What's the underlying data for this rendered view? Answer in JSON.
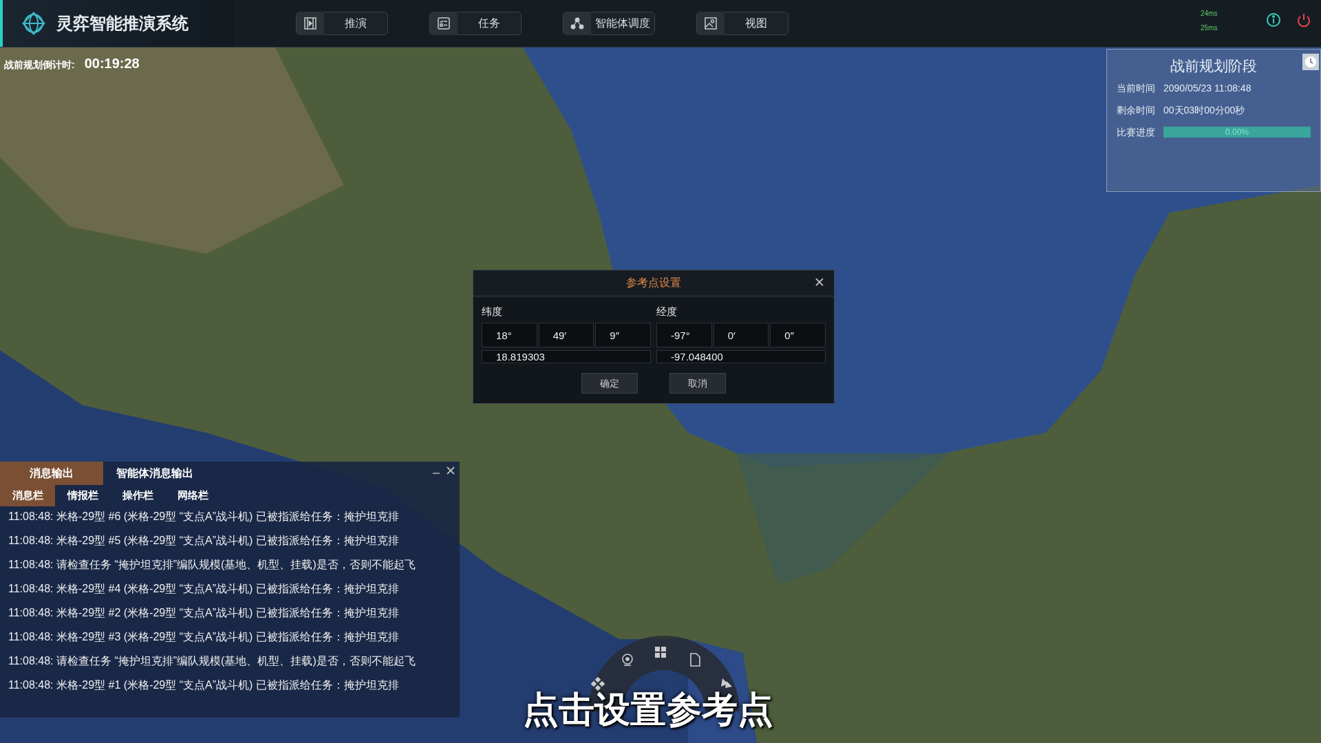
{
  "app": {
    "title": "灵弈智能推演系统"
  },
  "nav": [
    {
      "label": "推演"
    },
    {
      "label": "任务"
    },
    {
      "label": "智能体调度"
    },
    {
      "label": "视图"
    }
  ],
  "latency": [
    "24ms",
    "25ms"
  ],
  "countdown": {
    "label": "战前规划倒计时:",
    "value": "00:19:28"
  },
  "phase_panel": {
    "title": "战前规划阶段",
    "rows": [
      {
        "label": "当前时间",
        "value": "2090/05/23 11:08:48"
      },
      {
        "label": "剩余时间",
        "value": "00天03时00分00秒"
      }
    ],
    "progress": {
      "label": "比赛进度",
      "level": 0,
      "reading": "0.00%"
    }
  },
  "dialog": {
    "title": "参考点设置",
    "latitude": {
      "label": "纬度",
      "parts": [
        "18°",
        "49′",
        "9″"
      ],
      "decimal": "18.819303"
    },
    "longitude": {
      "label": "经度",
      "parts": [
        "-97°",
        "0′",
        "0″"
      ],
      "decimal": "-97.048400"
    },
    "buttons": [
      "确定",
      "取消"
    ]
  },
  "messages": {
    "tabs": [
      {
        "label": "消息输出",
        "selected": true
      },
      {
        "label": "智能体消息输出",
        "selected": false
      }
    ],
    "subtabs": [
      {
        "label": "消息栏",
        "selected": true
      },
      {
        "label": "情报栏",
        "selected": false
      },
      {
        "label": "操作栏",
        "selected": false
      },
      {
        "label": "网络栏",
        "selected": false
      }
    ],
    "lines": [
      "11:08:48: 米格-29型 #6 (米格-29型 “支点A”战斗机) 已被指派给任务：掩护坦克排",
      "11:08:48: 米格-29型 #5 (米格-29型 “支点A”战斗机) 已被指派给任务：掩护坦克排",
      "11:08:48: 请检查任务 “掩护坦克排”编队规模(基地、机型、挂载)是否，否则不能起飞",
      "11:08:48: 米格-29型 #4 (米格-29型 “支点A”战斗机) 已被指派给任务：掩护坦克排",
      "11:08:48: 米格-29型 #2 (米格-29型 “支点A”战斗机) 已被指派给任务：掩护坦克排",
      "11:08:48: 米格-29型 #3 (米格-29型 “支点A”战斗机) 已被指派给任务：掩护坦克排",
      "11:08:48: 请检查任务 “掩护坦克排”编队规模(基地、机型、挂载)是否，否则不能起飞",
      "11:08:48: 米格-29型 #1 (米格-29型 “支点A”战斗机) 已被指派给任务：掩护坦克排"
    ]
  },
  "subtitle": "点击设置参考点"
}
